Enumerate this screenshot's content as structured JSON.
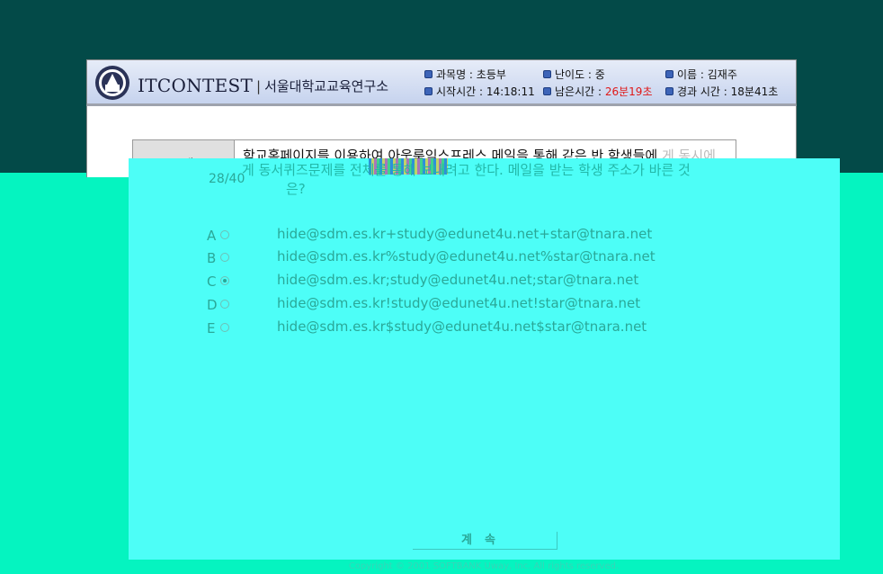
{
  "header": {
    "brand": "ITCONTEST",
    "org_separator": "|",
    "org": "서울대학교교육연구소",
    "subject": "과목명 : 초등부",
    "difficulty": "난이도 : 중",
    "name": "이름 : 김재주",
    "start_time": "시작시간 : 14:18:11",
    "remaining_label": "남은시간 :",
    "remaining_value": "26분19초",
    "elapsed": "경과 시간 : 18분41초"
  },
  "question": {
    "label": "문제",
    "counter": "28/40",
    "line1": "학교홈페이지를 이용하여 아웃룩익스프레스 메일을 통해 같은 반 학생들에",
    "line1_faded": "게 동시에",
    "line2": "게 동서퀴즈문제를 전체를 통해 보내려고 한다. 메일을 받는 학생 주소가 바른 것",
    "line3": "은?"
  },
  "options": [
    {
      "letter": "A",
      "text": "hide@sdm.es.kr+study@edunet4u.net+star@tnara.net",
      "selected": false
    },
    {
      "letter": "B",
      "text": "hide@sdm.es.kr%study@edunet4u.net%star@tnara.net",
      "selected": false
    },
    {
      "letter": "C",
      "text": "hide@sdm.es.kr;study@edunet4u.net;star@tnara.net",
      "selected": true
    },
    {
      "letter": "D",
      "text": "hide@sdm.es.kr!study@edunet4u.net!star@tnara.net",
      "selected": false
    },
    {
      "letter": "E",
      "text": "hide@sdm.es.kr$study@edunet4u.net$star@tnara.net",
      "selected": false
    }
  ],
  "continue_label": "계속",
  "copyright": "Copyright © 2001 SOFTBANK Uway, Inc. All rights reserved.",
  "colors": {
    "remaining": "#e01818",
    "bg": "#034a48",
    "cyan": "#4dfef7"
  }
}
